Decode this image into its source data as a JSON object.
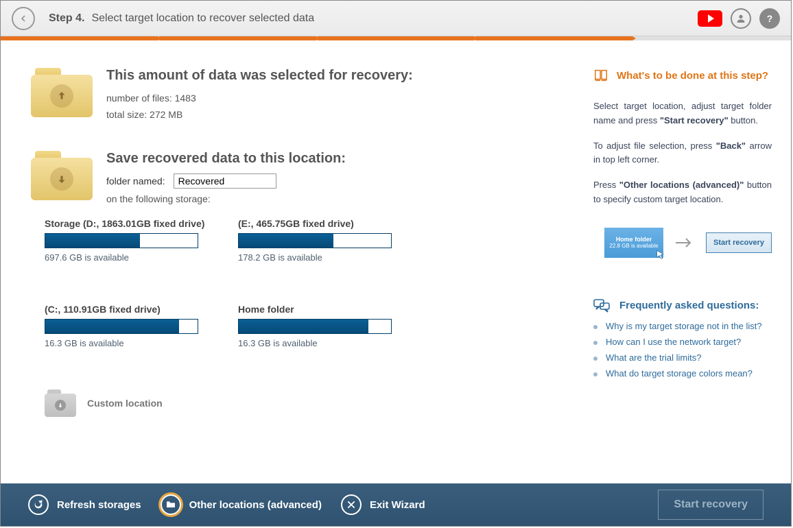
{
  "header": {
    "step_label": "Step 4.",
    "step_desc": "Select target location to recover selected data"
  },
  "summary": {
    "title": "This amount of data was selected for recovery:",
    "files_line": "number of files: 1483",
    "size_line": "total size: 272 MB"
  },
  "target": {
    "title": "Save recovered data to this location:",
    "folder_named_label": "folder named:",
    "folder_name_value": "Recovered",
    "on_storage_label": "on the following storage:"
  },
  "storages": [
    {
      "title": "Storage (D:, 1863.01GB fixed drive)",
      "avail": "697.6 GB is available",
      "fill_pct": 62
    },
    {
      "title": "(E:, 465.75GB fixed drive)",
      "avail": "178.2 GB is available",
      "fill_pct": 62
    },
    {
      "title": "(C:, 110.91GB fixed drive)",
      "avail": "16.3 GB is available",
      "fill_pct": 88
    },
    {
      "title": "Home folder",
      "avail": "16.3 GB is available",
      "fill_pct": 85
    }
  ],
  "custom_location_label": "Custom location",
  "right": {
    "heading": "What's to be done at this step?",
    "p1_a": "Select target location, adjust target folder name and press ",
    "p1_b": "\"Start recovery\"",
    "p1_c": " button.",
    "p2_a": "To adjust file selection, press ",
    "p2_b": "\"Back\"",
    "p2_c": " arrow in top left corner.",
    "p3_a": "Press ",
    "p3_b": "\"Other locations (advanced)\"",
    "p3_c": " button to specify custom target location.",
    "demo_title": "Home folder",
    "demo_sub": "22.8 GB is available",
    "demo_btn": "Start recovery",
    "faq_heading": "Frequently asked questions:",
    "faq": [
      "Why is my target storage not in the list?",
      "How can I use the network target?",
      "What are the trial limits?",
      "What do target storage colors mean?"
    ]
  },
  "footer": {
    "refresh": "Refresh storages",
    "other": "Other locations (advanced)",
    "exit": "Exit Wizard",
    "start": "Start recovery"
  }
}
